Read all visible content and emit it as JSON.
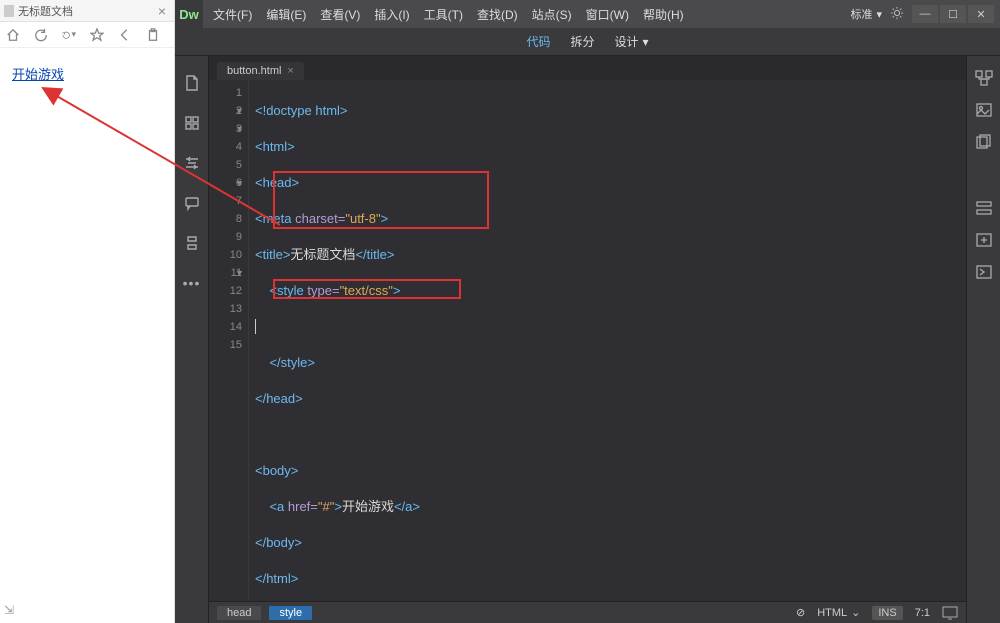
{
  "browser": {
    "tab_title": "无标题文档",
    "link_text": "开始游戏"
  },
  "menus": [
    "文件(F)",
    "编辑(E)",
    "查看(V)",
    "插入(I)",
    "工具(T)",
    "查找(D)",
    "站点(S)",
    "窗口(W)",
    "帮助(H)"
  ],
  "layout_label": "标准",
  "view_modes": {
    "code": "代码",
    "split": "拆分",
    "design": "设计"
  },
  "file_tab": "button.html",
  "code": {
    "l1": "<!doctype html>",
    "l2_open": "<html>",
    "l3_open": "<head>",
    "l4_tag_open": "<meta ",
    "l4_attr": "charset=",
    "l4_str": "\"utf-8\"",
    "l4_tag_close": ">",
    "l5_open": "<title>",
    "l5_text": "无标题文档",
    "l5_close": "</title>",
    "l6_open": "<style ",
    "l6_attr": "type=",
    "l6_str": "\"text/css\"",
    "l6_close": ">",
    "l7": "",
    "l8": "</style>",
    "l9": "</head>",
    "l10": "",
    "l11_open": "<body>",
    "l12_open": "<a ",
    "l12_attr": "href=",
    "l12_str": "\"#\"",
    "l12_mid": ">",
    "l12_text": "开始游戏",
    "l12_close": "</a>",
    "l13": "</body>",
    "l14": "</html>"
  },
  "line_numbers": [
    "1",
    "2",
    "3",
    "4",
    "5",
    "6",
    "7",
    "8",
    "9",
    "10",
    "11",
    "12",
    "13",
    "14",
    "15"
  ],
  "breadcrumb": {
    "head": "head",
    "style": "style"
  },
  "status": {
    "err_icon": "⊘",
    "lang": "HTML",
    "ins": "INS",
    "pos": "7:1"
  }
}
